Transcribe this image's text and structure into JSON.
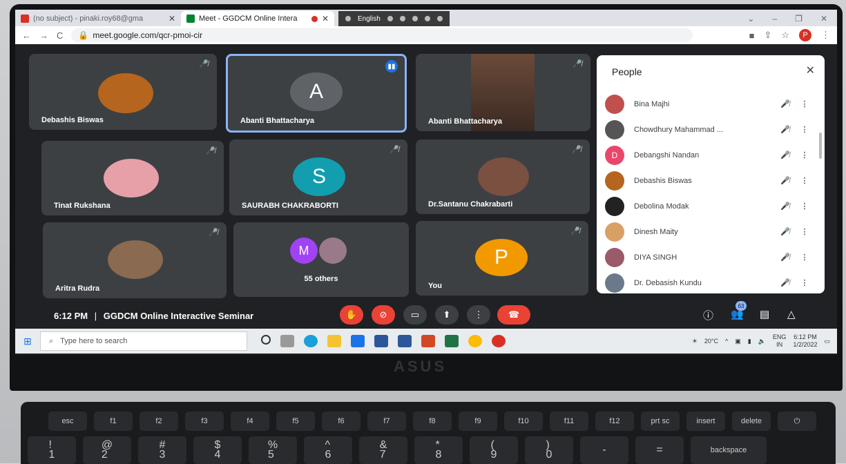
{
  "browser": {
    "tabs": [
      {
        "title": "(no subject) - pinaki.roy68@gma",
        "close": "✕",
        "favicon_color": "#d93025"
      },
      {
        "title": "Meet - GGDCM Online Intera",
        "close": "✕",
        "favicon_color": "#00832d",
        "active": true
      }
    ],
    "ime_label": "English",
    "url": "meet.google.com/qcr-pmoi-cir",
    "profile_initial": "P"
  },
  "tiles": [
    {
      "name": "Debashis Biswas",
      "type": "photo",
      "color": "#b5651d"
    },
    {
      "name": "Abanti Bhattacharya",
      "type": "initial",
      "initial": "A",
      "color": "#5f6368",
      "speaking": true
    },
    {
      "name": "Abanti Bhattacharya",
      "type": "video",
      "color": "#6b4a3a"
    },
    {
      "name": "Tinat Rukshana",
      "type": "photo",
      "color": "#e8a0a8"
    },
    {
      "name": "SAURABH CHAKRABORTI",
      "type": "initial",
      "initial": "S",
      "color": "#129eaf"
    },
    {
      "name": "Dr.Santanu Chakrabarti",
      "type": "photo",
      "color": "#7a5040"
    },
    {
      "name": "Aritra Rudra",
      "type": "photo",
      "color": "#8a6a50"
    },
    {
      "name": "55 others",
      "type": "others",
      "initial": "M",
      "color": "#a142f4"
    },
    {
      "name": "You",
      "type": "initial",
      "initial": "P",
      "color": "#f29900"
    }
  ],
  "people_panel": {
    "title": "People",
    "close": "✕",
    "participants": [
      {
        "name": "Bina Majhi",
        "color": "#c0504d"
      },
      {
        "name": "Chowdhury Mahammad ...",
        "color": "#555555"
      },
      {
        "name": "Debangshi Nandan",
        "initial": "D",
        "color": "#e8476a"
      },
      {
        "name": "Debashis Biswas",
        "color": "#b5651d"
      },
      {
        "name": "Debolina Modak",
        "color": "#222222"
      },
      {
        "name": "Dinesh Maity",
        "color": "#d9a066"
      },
      {
        "name": "DIYA SINGH",
        "color": "#9a5a6a"
      },
      {
        "name": "Dr. Debasish Kundu",
        "color": "#6a7a8a"
      }
    ]
  },
  "meeting": {
    "time": "6:12 PM",
    "separator": "|",
    "title": "GGDCM Online Interactive Seminar",
    "participant_count": "63"
  },
  "taskbar": {
    "search_placeholder": "Type here to search",
    "temperature": "20°C",
    "lang_top": "ENG",
    "lang_bottom": "IN",
    "time": "6:12 PM",
    "date": "1/2/2022"
  },
  "brand": "ASUS",
  "keyboard": {
    "row1": [
      "esc",
      "f1",
      "f2",
      "f3",
      "f4",
      "f5",
      "f6",
      "f7",
      "f8",
      "f9",
      "f10",
      "f11",
      "f12",
      "prt sc",
      "insert",
      "delete",
      "⏻"
    ],
    "row2": [
      "!\n1",
      "@\n2",
      "#\n3",
      "$\n4",
      "%\n5",
      "^\n6",
      "&\n7",
      "*\n8",
      "(\n9",
      ")\n0",
      "-",
      "=",
      "backspace"
    ]
  }
}
